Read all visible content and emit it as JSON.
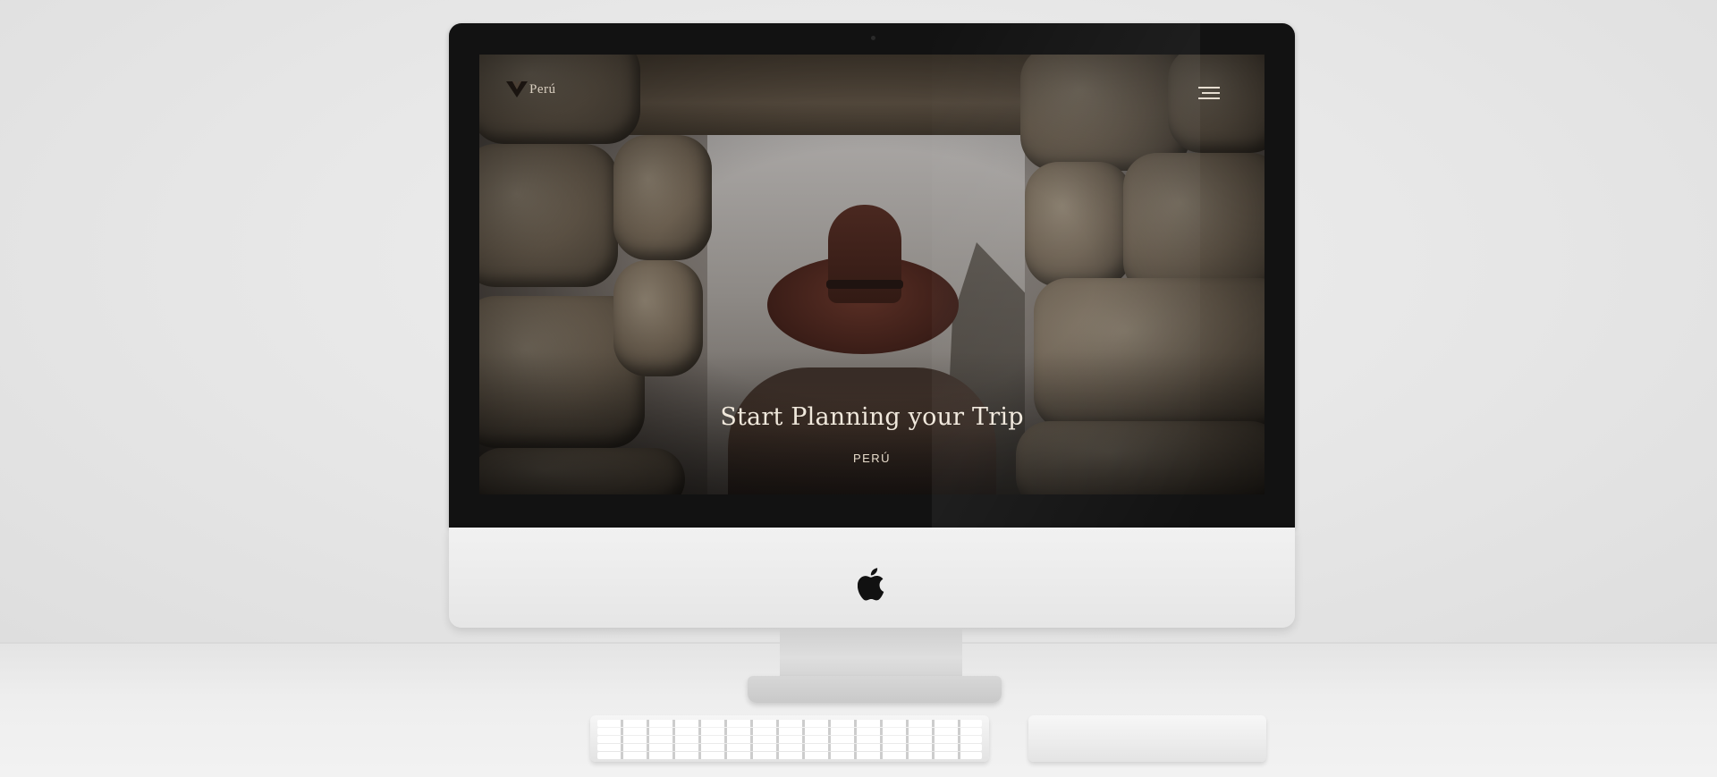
{
  "website": {
    "brand": {
      "name": "Perú",
      "logo_icon": "v-chevron-logo-icon"
    },
    "menu": {
      "icon": "hamburger-menu-icon"
    },
    "hero": {
      "title": "Start Planning your Trip",
      "subtitle": "PERÚ"
    }
  },
  "device": {
    "type": "iMac",
    "logo_icon": "apple-logo-icon"
  },
  "colors": {
    "hero_text": "#f0e8dc",
    "brand_text": "#d9cfc0",
    "bezel": "#121212"
  }
}
